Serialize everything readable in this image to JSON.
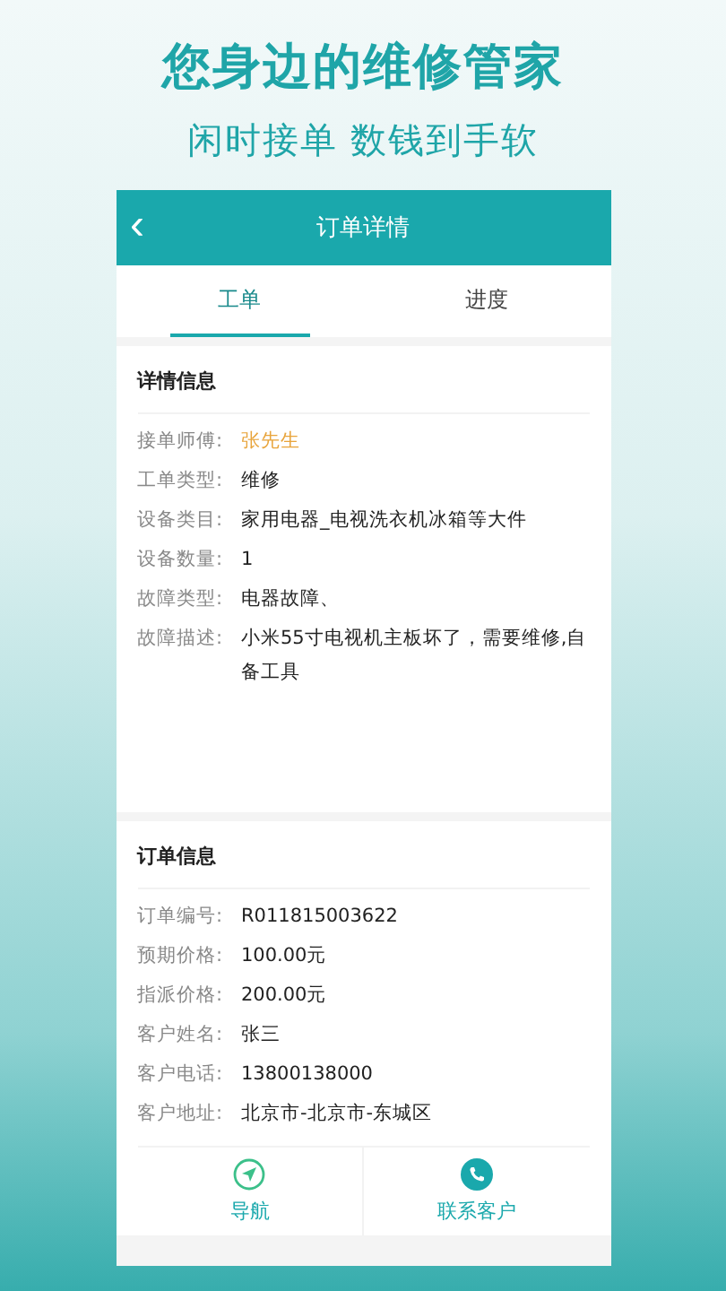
{
  "headline": "您身边的维修管家",
  "subtitle": "闲时接单 数钱到手软",
  "header": {
    "back": "‹",
    "title": "订单详情"
  },
  "tabs": [
    {
      "label": "工单",
      "selected": true
    },
    {
      "label": "进度",
      "selected": false
    }
  ],
  "detail": {
    "title": "详情信息",
    "rows": [
      {
        "label": "接单师傅:",
        "value": "张先生",
        "highlighted": true
      },
      {
        "label": "工单类型:",
        "value": "维修",
        "highlighted": false
      },
      {
        "label": "设备类目:",
        "value": "家用电器_电视洗衣机冰箱等大件",
        "highlighted": false
      },
      {
        "label": "设备数量:",
        "value": "1",
        "highlighted": false
      },
      {
        "label": "故障类型:",
        "value": "电器故障、",
        "highlighted": false
      },
      {
        "label": "故障描述:",
        "value": "小米55寸电视机主板坏了，需要维修,自备工具",
        "highlighted": false
      }
    ]
  },
  "order": {
    "title": "订单信息",
    "rows": [
      {
        "label": "订单编号:",
        "value": "R011815003622"
      },
      {
        "label": "预期价格:",
        "value": "100.00元"
      },
      {
        "label": "指派价格:",
        "value": "200.00元"
      },
      {
        "label": "客户姓名:",
        "value": "张三"
      },
      {
        "label": "客户电话:",
        "value": "13800138000"
      },
      {
        "label": "客户地址:",
        "value": "北京市-北京市-东城区"
      }
    ]
  },
  "actions": [
    {
      "kind": "navigate",
      "label": "导航"
    },
    {
      "kind": "call",
      "label": "联系客户"
    }
  ]
}
